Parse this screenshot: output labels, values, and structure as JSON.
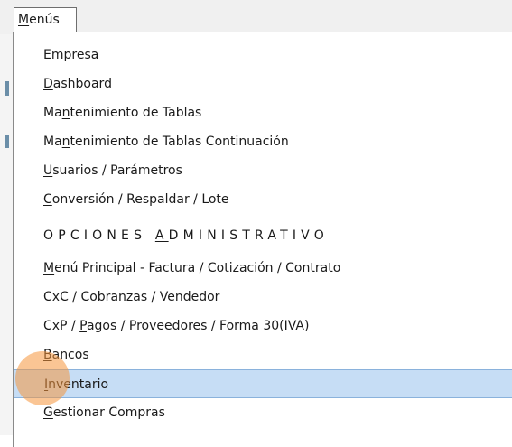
{
  "menubar": {
    "menu": {
      "label": "Menús",
      "ul": "M",
      "rest": "enús"
    }
  },
  "dropdown": {
    "items": [
      {
        "pre": "",
        "ul": "E",
        "post": "mpresa"
      },
      {
        "pre": "",
        "ul": "D",
        "post": "ashboard"
      },
      {
        "pre": "Ma",
        "ul": "n",
        "post": "tenimiento de Tablas"
      },
      {
        "pre": "Ma",
        "ul": "n",
        "post": "tenimiento de Tablas Continuación"
      },
      {
        "pre": "",
        "ul": "U",
        "post": "suarios / Parámetros"
      },
      {
        "pre": "",
        "ul": "C",
        "post": "onversión / Respaldar / Lote"
      }
    ],
    "section_heading": {
      "pre": "OPCIONES ",
      "ul": "A",
      "post": "DMINISTRATIVO"
    },
    "items2": [
      {
        "pre": "",
        "ul": "M",
        "post": "enú Principal - Factura / Cotización / Contrato"
      },
      {
        "pre": "",
        "ul": "C",
        "post": "xC / Cobranzas / Vendedor"
      },
      {
        "pre": "CxP / ",
        "ul": "P",
        "post": "agos / Proveedores / Forma 30(IVA)"
      },
      {
        "pre": "",
        "ul": "B",
        "post": "ancos"
      },
      {
        "pre": "",
        "ul": "I",
        "post": "nventario"
      },
      {
        "pre": "",
        "ul": "G",
        "post": "estionar Compras"
      }
    ]
  },
  "colors": {
    "selected_bg": "#c6ddf5",
    "cursor_highlight": "#f5963c"
  }
}
